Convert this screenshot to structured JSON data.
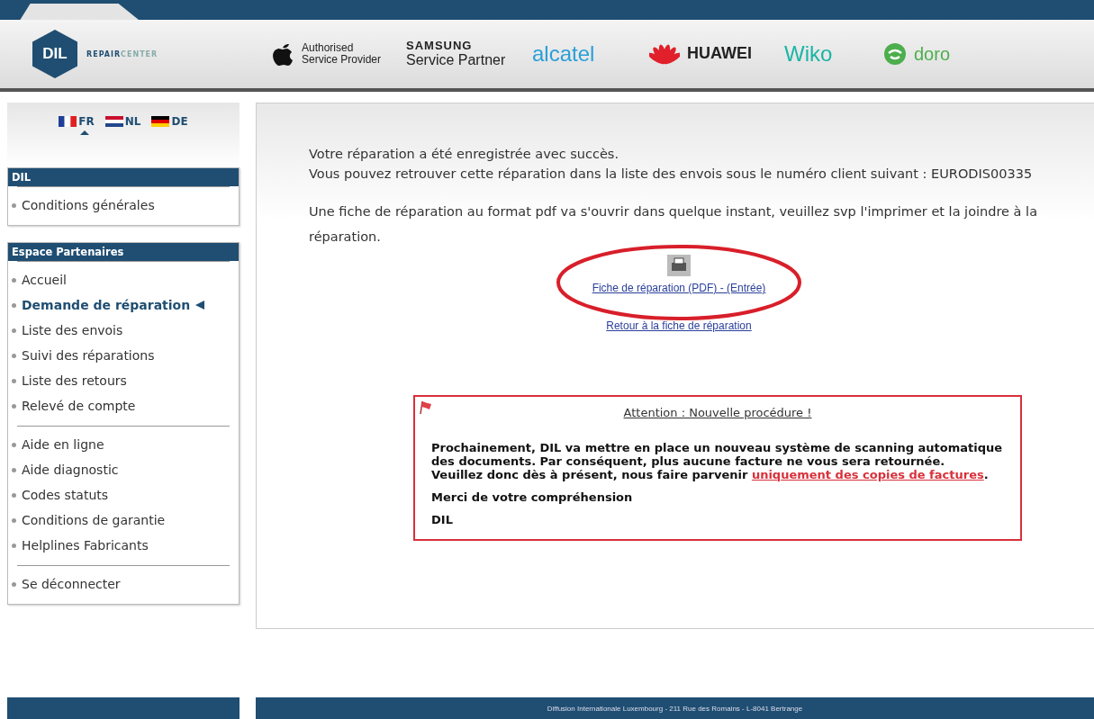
{
  "header": {
    "brand": {
      "mark": "DIL",
      "name_bold": "REPAIR",
      "name_light": "CENTER"
    },
    "partners": [
      {
        "kind": "apple",
        "lines": [
          "Authorised",
          "Service Provider"
        ]
      },
      {
        "kind": "samsung",
        "lines": [
          "SAMSUNG",
          "Service Partner"
        ]
      },
      {
        "kind": "alcatel",
        "lines": [
          "alcatel"
        ]
      },
      {
        "kind": "huawei",
        "lines": [
          "HUAWEI"
        ]
      },
      {
        "kind": "wiko",
        "lines": [
          "Wiko"
        ]
      },
      {
        "kind": "doro",
        "lines": [
          "doro"
        ]
      }
    ]
  },
  "languages": [
    {
      "code": "FR",
      "selected": true
    },
    {
      "code": "NL",
      "selected": false
    },
    {
      "code": "DE",
      "selected": false
    }
  ],
  "sidebar": [
    {
      "title": "DIL",
      "groups": [
        [
          {
            "label": "Conditions générales",
            "selected": false
          }
        ]
      ]
    },
    {
      "title": "Espace Partenaires",
      "groups": [
        [
          {
            "label": "Accueil",
            "selected": false
          },
          {
            "label": "Demande de réparation",
            "selected": true
          },
          {
            "label": "Liste des envois",
            "selected": false
          },
          {
            "label": "Suivi des réparations",
            "selected": false
          },
          {
            "label": "Liste des retours",
            "selected": false
          },
          {
            "label": "Relevé de compte",
            "selected": false
          }
        ],
        [
          {
            "label": "Aide en ligne",
            "selected": false
          },
          {
            "label": "Aide diagnostic",
            "selected": false
          },
          {
            "label": "Codes statuts",
            "selected": false
          },
          {
            "label": "Conditions de garantie",
            "selected": false
          },
          {
            "label": "Helplines Fabricants",
            "selected": false
          }
        ],
        [
          {
            "label": "Se déconnecter",
            "selected": false
          }
        ]
      ]
    }
  ],
  "main": {
    "messages": [
      "Votre réparation a été enregistrée avec succès.",
      "Vous pouvez retrouver cette réparation dans la liste des envois sous le numéro client suivant : EURODIS00335"
    ],
    "pdf_notice": "Une fiche de réparation au format pdf va s'ouvrir dans quelque instant, veuillez svp l'imprimer et la joindre à la réparation.",
    "pdf_link": "Fiche de réparation (PDF) - (Entrée)",
    "back_link": "Retour à la fiche de réparation",
    "notice": {
      "title": "Attention : Nouvelle procédure !",
      "body": "Prochainement, DIL va mettre en place un nouveau système de scanning automatique des documents. Par conséquent, plus aucune facture ne vous sera retournée.",
      "body2": "Veuillez donc dès à présent, nous faire parvenir",
      "link": "uniquement des copies de factures",
      "link_end": ".",
      "thanks": "Merci de votre compréhension",
      "signature": "DIL"
    }
  },
  "footer": "Diffusion Internationale Luxembourg - 211 Rue des Romains - L-8041 Bertrange"
}
